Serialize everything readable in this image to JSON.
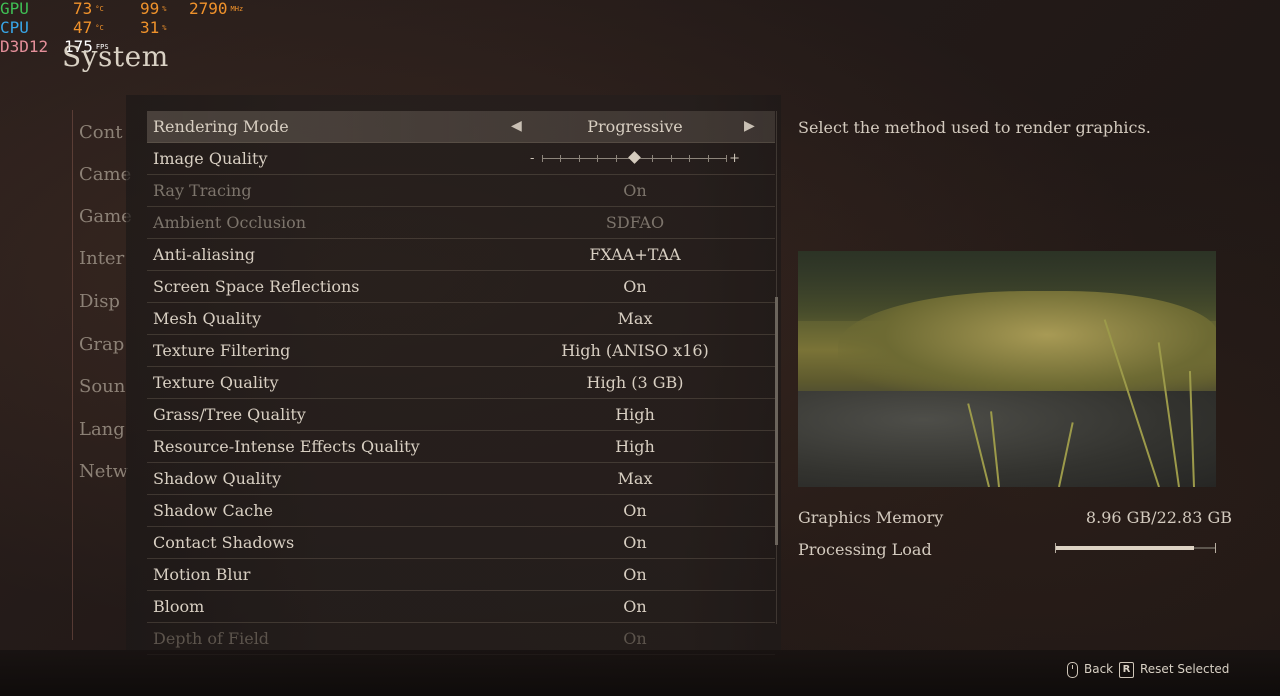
{
  "overlay": {
    "gpu_label": "GPU",
    "gpu_temp": "73",
    "gpu_temp_unit": "°C",
    "gpu_usage": "99",
    "gpu_usage_unit": "%",
    "gpu_clock": "2790",
    "gpu_clock_unit": "MHz",
    "cpu_label": "CPU",
    "cpu_temp": "47",
    "cpu_temp_unit": "°C",
    "cpu_usage": "31",
    "cpu_usage_unit": "%",
    "api_label": "D3D12",
    "fps": "175",
    "fps_unit": "FPS"
  },
  "page_title": "System",
  "categories": [
    "Cont",
    "Came",
    "Game",
    "Inter",
    "Disp",
    "Grap",
    "Soun",
    "Lang",
    "Netw"
  ],
  "settings": [
    {
      "name": "Rendering Mode",
      "value": "Progressive",
      "state": "selected"
    },
    {
      "name": "Image Quality",
      "value": "",
      "state": "slider"
    },
    {
      "name": "Ray Tracing",
      "value": "On",
      "state": "disabled"
    },
    {
      "name": "Ambient Occlusion",
      "value": "SDFAO",
      "state": "disabled"
    },
    {
      "name": "Anti-aliasing",
      "value": "FXAA+TAA",
      "state": "normal"
    },
    {
      "name": "Screen Space Reflections",
      "value": "On",
      "state": "normal"
    },
    {
      "name": "Mesh Quality",
      "value": "Max",
      "state": "normal"
    },
    {
      "name": "Texture Filtering",
      "value": "High (ANISO x16)",
      "state": "normal"
    },
    {
      "name": "Texture Quality",
      "value": "High (3 GB)",
      "state": "normal"
    },
    {
      "name": "Grass/Tree Quality",
      "value": "High",
      "state": "normal"
    },
    {
      "name": "Resource-Intense Effects Quality",
      "value": "High",
      "state": "normal"
    },
    {
      "name": "Shadow Quality",
      "value": "Max",
      "state": "normal"
    },
    {
      "name": "Shadow Cache",
      "value": "On",
      "state": "normal"
    },
    {
      "name": "Contact Shadows",
      "value": "On",
      "state": "normal"
    },
    {
      "name": "Motion Blur",
      "value": "On",
      "state": "normal"
    },
    {
      "name": "Bloom",
      "value": "On",
      "state": "normal"
    },
    {
      "name": "Depth of Field",
      "value": "On",
      "state": "faded"
    }
  ],
  "image_quality_slider": {
    "minus": "-",
    "plus": "+",
    "level": 0.5
  },
  "description": "Select the method used to render graphics.",
  "graphics_memory": {
    "label": "Graphics Memory",
    "value": "8.96 GB/22.83 GB"
  },
  "processing_load": {
    "label": "Processing Load",
    "level": 0.87
  },
  "footer": {
    "back_label": "Back",
    "reset_key": "R",
    "reset_label": "Reset Selected"
  },
  "colors": {
    "overlay_value": "#f0922b",
    "gpu": "#3fbf54",
    "cpu": "#38a6e8",
    "api": "#e58f9a"
  }
}
